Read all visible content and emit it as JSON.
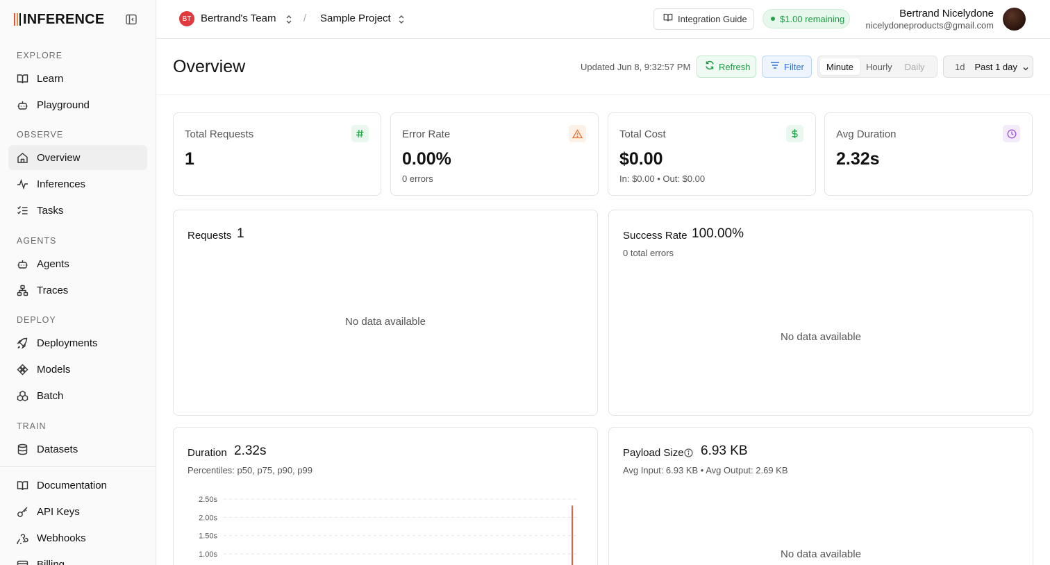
{
  "brand": {
    "name": "INFERENCE"
  },
  "sidebar": {
    "sections": {
      "explore": "EXPLORE",
      "observe": "OBSERVE",
      "agents": "AGENTS",
      "deploy": "DEPLOY",
      "train": "TRAIN"
    },
    "items": {
      "learn": "Learn",
      "playground": "Playground",
      "overview": "Overview",
      "inferences": "Inferences",
      "tasks": "Tasks",
      "agents": "Agents",
      "traces": "Traces",
      "deployments": "Deployments",
      "models": "Models",
      "batch": "Batch",
      "datasets": "Datasets",
      "documentation": "Documentation",
      "api_keys": "API Keys",
      "webhooks": "Webhooks",
      "billing": "Billing"
    },
    "active": "overview"
  },
  "header": {
    "team_initials": "BT",
    "team_name": "Bertrand's Team",
    "separator": "/",
    "project_name": "Sample Project",
    "integration_guide": "Integration Guide",
    "credits": "$1.00 remaining",
    "user_name": "Bertrand Nicelydone",
    "user_email": "nicelydoneproducts@gmail.com"
  },
  "page": {
    "title": "Overview",
    "updated": "Updated Jun 8, 9:32:57 PM",
    "refresh": "Refresh",
    "filter": "Filter",
    "granularity": {
      "minute": "Minute",
      "hourly": "Hourly",
      "daily": "Daily",
      "selected": "Minute"
    },
    "range_short": "1d",
    "range_label": "Past 1 day"
  },
  "stats": {
    "total_requests": {
      "label": "Total Requests",
      "value": "1"
    },
    "error_rate": {
      "label": "Error Rate",
      "value": "0.00%",
      "sub": "0 errors"
    },
    "total_cost": {
      "label": "Total Cost",
      "value": "$0.00",
      "sub": "In: $0.00 • Out: $0.00"
    },
    "avg_duration": {
      "label": "Avg Duration",
      "value": "2.32s"
    }
  },
  "panels": {
    "requests": {
      "title": "Requests",
      "value": "1",
      "empty": "No data available"
    },
    "success_rate": {
      "title": "Success Rate",
      "value": "100.00%",
      "sub": "0 total errors",
      "empty": "No data available"
    },
    "duration": {
      "title": "Duration",
      "value": "2.32s",
      "sub": "Percentiles: p50, p75, p90, p99"
    },
    "payload": {
      "title": "Payload Size",
      "value": "6.93 KB",
      "sub": "Avg Input: 6.93 KB • Avg Output: 2.69 KB",
      "empty": "No data available"
    }
  },
  "colors": {
    "accent_green": "#1f9a45",
    "accent_blue": "#2f72d6",
    "accent_red": "#e35336",
    "duration_line": "#e8604c"
  },
  "chart_data": {
    "type": "line",
    "yticks": [
      "2.50s",
      "2.00s",
      "1.50s",
      "1.00s"
    ],
    "ylim": [
      0,
      2.5
    ],
    "series": [
      {
        "values": [
          2.32
        ]
      }
    ],
    "grid": true
  }
}
